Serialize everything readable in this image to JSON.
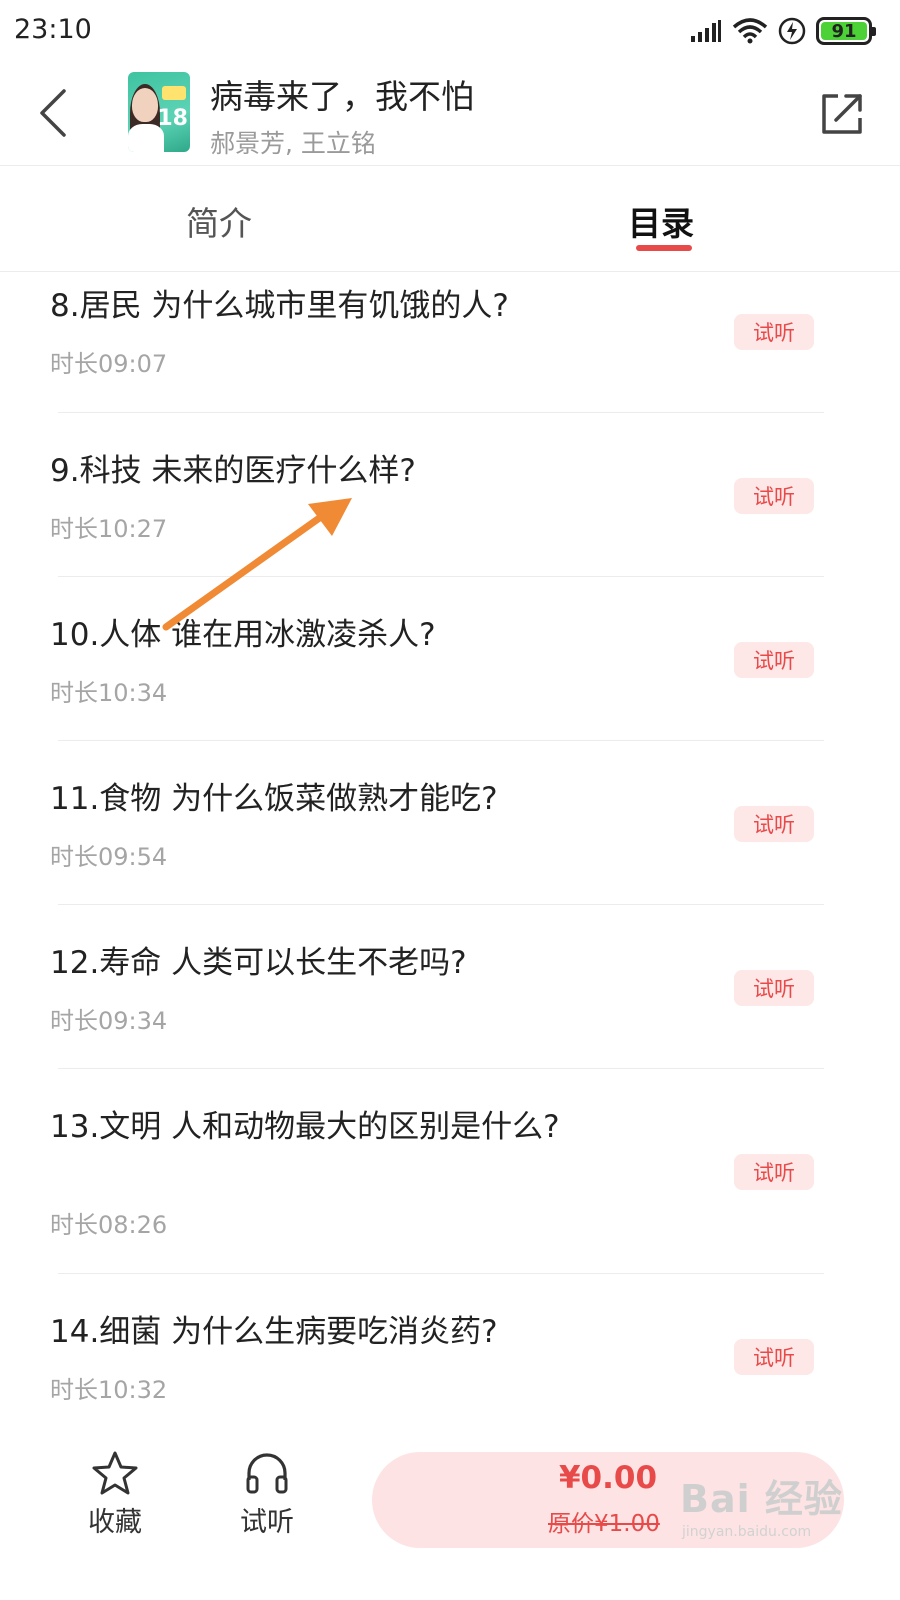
{
  "status_bar": {
    "time": "23:10",
    "battery": "91",
    "battery_color": "#4cd137"
  },
  "header": {
    "title": "病毒来了，我不怕",
    "authors": "郝景芳, 王立铭",
    "cover_number": "18",
    "icons": {
      "back": "chevron-left-icon",
      "share": "share-icon"
    }
  },
  "tabs": [
    {
      "label": "简介",
      "active": false
    },
    {
      "label": "目录",
      "active": true
    }
  ],
  "accent_color": "#e84a4a",
  "episodes": [
    {
      "title": "8.居民  为什么城市里有饥饿的人?",
      "duration": "时长09:07",
      "badge": "试听"
    },
    {
      "title": "9.科技  未来的医疗什么样?",
      "duration": "时长10:27",
      "badge": "试听"
    },
    {
      "title": "10.人体  谁在用冰激凌杀人?",
      "duration": "时长10:34",
      "badge": "试听"
    },
    {
      "title": "11.食物  为什么饭菜做熟才能吃?",
      "duration": "时长09:54",
      "badge": "试听"
    },
    {
      "title": "12.寿命  人类可以长生不老吗?",
      "duration": "时长09:34",
      "badge": "试听"
    },
    {
      "title": "13.文明  人和动物最大的区别是什么?",
      "duration": "时长08:26",
      "badge": "试听"
    },
    {
      "title": "14.细菌  为什么生病要吃消炎药?",
      "duration": "时长10:32",
      "badge": "试听"
    }
  ],
  "bottom_bar": {
    "favorite_label": "收藏",
    "trial_label": "试听",
    "price": "¥0.00",
    "original_price": "原价¥1.00"
  },
  "watermark": {
    "logo": "Bai 经验",
    "url": "jingyan.baidu.com"
  }
}
